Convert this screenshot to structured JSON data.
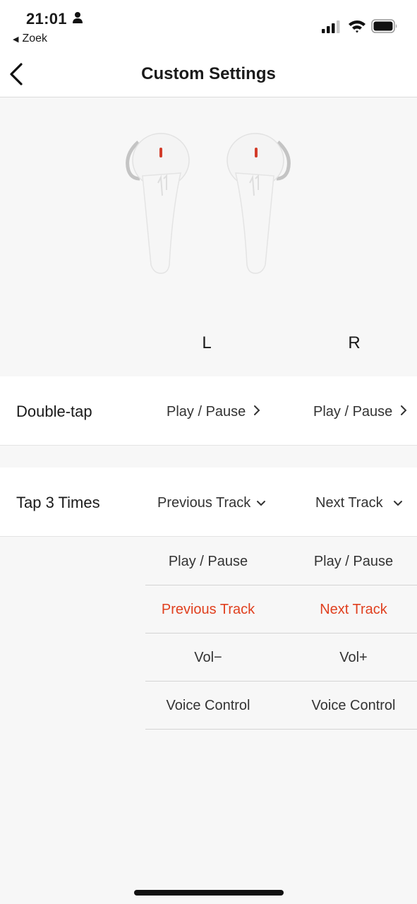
{
  "status_bar": {
    "time": "21:01",
    "back_app": "Zoek",
    "icons": [
      "person-icon",
      "signal-icon",
      "wifi-icon",
      "battery-icon"
    ]
  },
  "nav": {
    "title": "Custom Settings",
    "back_icon": "chevron-left-icon"
  },
  "earbuds": {
    "left_label": "L",
    "right_label": "R"
  },
  "rows": {
    "double_tap": {
      "label": "Double-tap",
      "left_value": "Play / Pause",
      "right_value": "Play / Pause"
    },
    "tap_three": {
      "label": "Tap 3 Times",
      "left_value": "Previous Track",
      "right_value": "Next Track"
    }
  },
  "options": {
    "left": [
      "Play / Pause",
      "Previous Track",
      "Vol−",
      "Voice Control"
    ],
    "right": [
      "Play / Pause",
      "Next Track",
      "Vol+",
      "Voice Control"
    ],
    "left_selected": "Previous Track",
    "right_selected": "Next Track"
  },
  "colors": {
    "accent": "#e0401f",
    "background": "#f7f7f7",
    "row_background": "#ffffff"
  }
}
